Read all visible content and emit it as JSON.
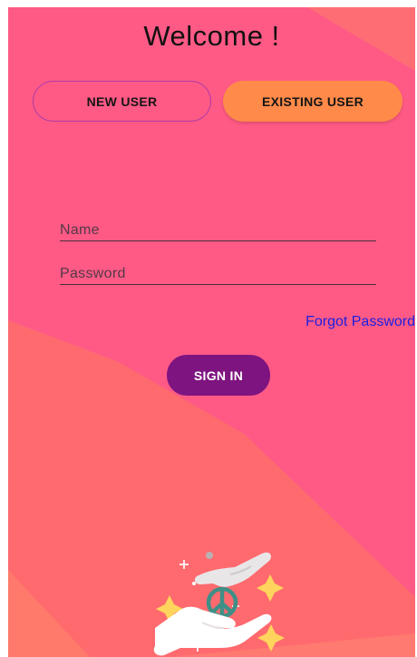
{
  "header": {
    "title": "Welcome !"
  },
  "user_type_toggle": {
    "new_user_label": "NEW USER",
    "existing_user_label": "EXISTING USER",
    "selected": "EXISTING USER"
  },
  "login_form": {
    "name_placeholder": "Name",
    "name_value": "",
    "password_placeholder": "Password",
    "password_value": "",
    "forgot_password_label": "Forgot Password",
    "sign_in_label": "SIGN IN"
  },
  "illustration": {
    "icon": "hands-peace-icon"
  },
  "colors": {
    "background_pink": "#ff5a86",
    "background_coral": "#ff6f6b",
    "selected_toggle": "#ff8a4a",
    "toggle_border": "#b23aa5",
    "sign_in_button": "#7e1480",
    "forgot_link": "#1b1fe0"
  }
}
